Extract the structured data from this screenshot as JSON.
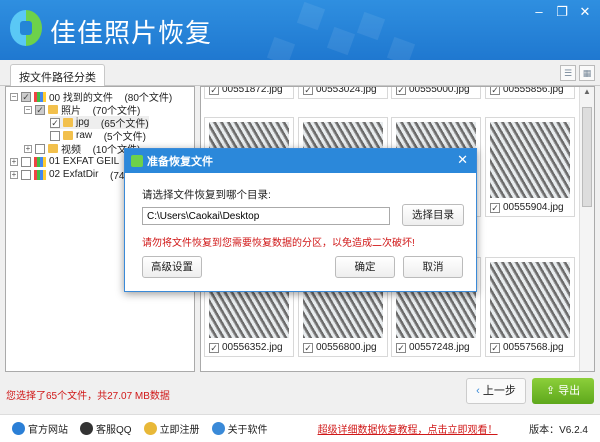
{
  "window": {
    "title": "佳佳照片恢复",
    "minimize": "–",
    "restore": "❐",
    "close": "✕"
  },
  "tabs": [
    {
      "label": "按文件路径分类"
    }
  ],
  "view_icons": [
    "list-view-icon",
    "thumbnail-view-icon"
  ],
  "tree": [
    {
      "label": "00 找到的文件",
      "count": "(80个文件)",
      "checked": "partial",
      "expanded": true
    },
    {
      "label": "照片",
      "count": "(70个文件)",
      "checked": "partial",
      "expanded": true
    },
    {
      "label": "jpg",
      "count": "(65个文件)",
      "checked": true
    },
    {
      "label": "raw",
      "count": "(5个文件)",
      "checked": false
    },
    {
      "label": "视频",
      "count": "(10个文件)",
      "checked": false
    },
    {
      "label": "01 EXFAT GEIL",
      "count": "(7",
      "checked": false
    },
    {
      "label": "02 ExfatDir",
      "count": "(74个",
      "checked": false
    }
  ],
  "files": {
    "row1": [
      "00551872.jpg",
      "00553024.jpg",
      "00555000.jpg",
      "00555856.jpg"
    ],
    "row2": [
      "",
      "",
      "",
      "00555904.jpg"
    ],
    "row3": [
      "00556352.jpg",
      "00556800.jpg",
      "00557248.jpg",
      "00557568.jpg"
    ]
  },
  "status": {
    "selection": "您选择了65个文件，共27.07 MB数据",
    "prev": "上一步",
    "export": "导出"
  },
  "bottom": {
    "site": "官方网站",
    "qq": "客服QQ",
    "register": "立即注册",
    "about": "关于软件",
    "tutorial": "超级详细数据恢复教程，点击立即观看！",
    "version": "版本：V6.2.4"
  },
  "dialog": {
    "title": "准备恢复文件",
    "prompt": "请选择文件恢复到哪个目录:",
    "path": "C:\\Users\\Caokai\\Desktop",
    "choose": "选择目录",
    "warning": "请勿将文件恢复到您需要恢复数据的分区，以免造成二次破坏!",
    "advanced": "高级设置",
    "ok": "确定",
    "cancel": "取消",
    "close": "✕"
  },
  "colors": {
    "header": "#2b88da",
    "warning": "#d01818",
    "export": "#6db526"
  }
}
